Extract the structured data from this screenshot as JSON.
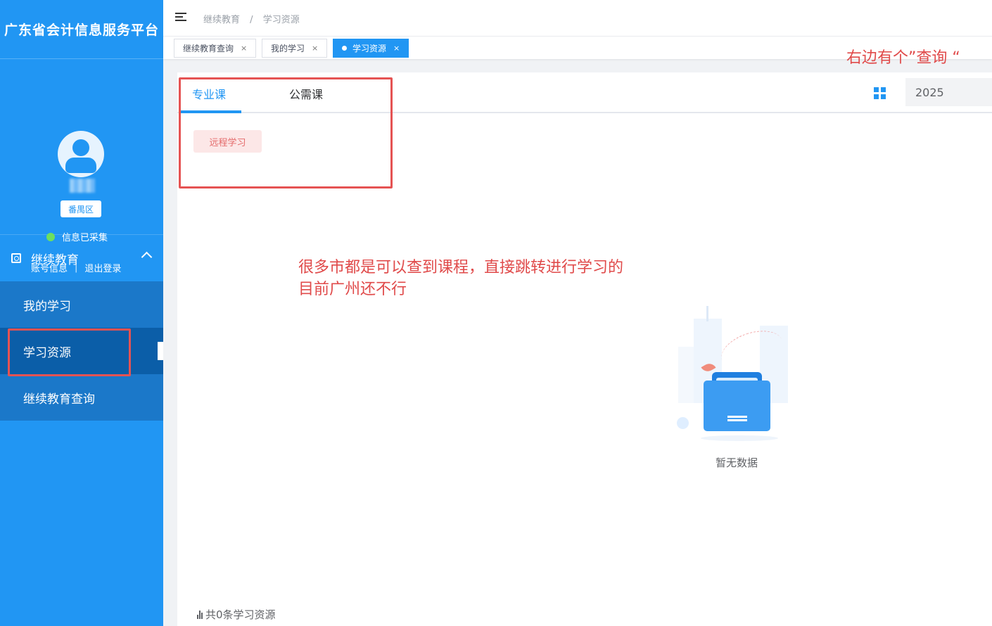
{
  "platform": {
    "name": "广东省会计信息服务平台"
  },
  "user": {
    "region": "番禺区",
    "status": "信息已采集",
    "account_link": "账号信息",
    "separator": "|",
    "logout_link": "退出登录"
  },
  "menu": {
    "section": "继续教育",
    "items": [
      {
        "label": "我的学习"
      },
      {
        "label": "学习资源"
      },
      {
        "label": "继续教育查询"
      }
    ]
  },
  "breadcrumb": {
    "root": "继续教育",
    "separator": "/",
    "current": "学习资源"
  },
  "tabs_bar": {
    "tags": [
      {
        "label": "继续教育查询",
        "close": "×"
      },
      {
        "label": "我的学习",
        "close": "×"
      },
      {
        "label": "学习资源",
        "close": "×"
      }
    ]
  },
  "content": {
    "tabs": [
      "专业课",
      "公需课"
    ],
    "subtag": "远程学习",
    "year": "2025",
    "empty_text": "暂无数据",
    "footer_count": "共0条学习资源"
  },
  "annotations": {
    "right": "右边有个”查询 “",
    "middle_line1": "很多市都是可以查到课程，直接跳转进行学习的",
    "middle_line2": "目前广州还不行"
  },
  "colors": {
    "primary": "#2196f3",
    "annotation": "#e04a4a"
  }
}
